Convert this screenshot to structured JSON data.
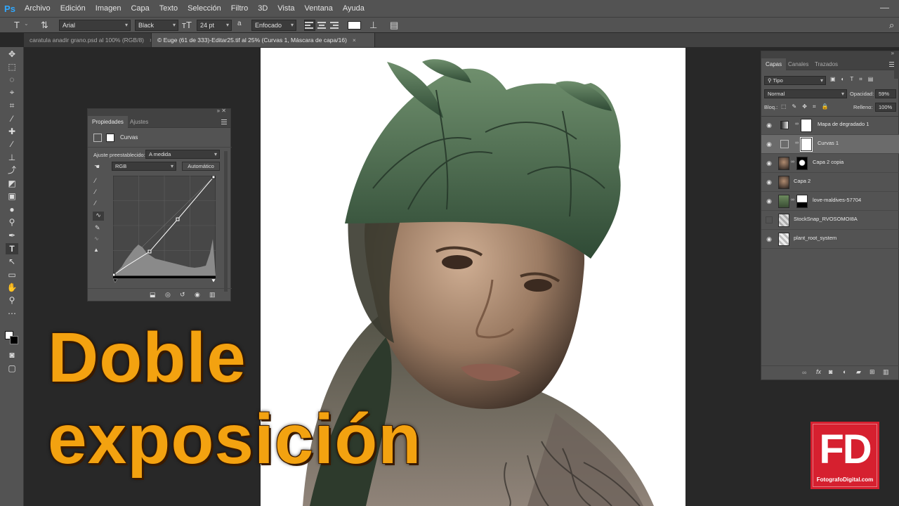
{
  "app": {
    "logo": "Ps",
    "menu": [
      "Archivo",
      "Edición",
      "Imagen",
      "Capa",
      "Texto",
      "Selección",
      "Filtro",
      "3D",
      "Vista",
      "Ventana",
      "Ayuda"
    ]
  },
  "options": {
    "font_family": "Arial",
    "font_style": "Black",
    "font_size": "24 pt",
    "aa_label": "a",
    "antialias": "Enfocado"
  },
  "tabs": [
    {
      "label": "caratula anadir grano.psd al 100% (RGB/8)",
      "close": "×"
    },
    {
      "label": "© Euge (61 de 333)-Editar25.tif al 25% (Curvas 1, Máscara de capa/16)",
      "close": "×"
    }
  ],
  "properties": {
    "tabs": [
      "Propiedades",
      "Ajustes"
    ],
    "title": "Curvas",
    "preset_label": "Ajuste preestablecido:",
    "preset_value": "A medida",
    "channel": "RGB",
    "auto_button": "Automático"
  },
  "layers_panel": {
    "tabs": [
      "Capas",
      "Canales",
      "Trazados"
    ],
    "filter": "Tipo",
    "blend_mode": "Normal",
    "opacity_label": "Opacidad:",
    "opacity_value": "59%",
    "lock_label": "Bloq.:",
    "fill_label": "Relleno:",
    "fill_value": "100%",
    "layers": [
      {
        "name": "Mapa de degradado 1",
        "visible": true,
        "selected": false
      },
      {
        "name": "Curvas 1",
        "visible": true,
        "selected": true
      },
      {
        "name": "Capa 2 copia",
        "visible": true,
        "selected": false
      },
      {
        "name": "Capa 2",
        "visible": true,
        "selected": false
      },
      {
        "name": "love-maldives-57704",
        "visible": true,
        "selected": false
      },
      {
        "name": "StockSnap_RVOSOMOI8A",
        "visible": false,
        "selected": false
      },
      {
        "name": "plant_root_system",
        "visible": true,
        "selected": false
      }
    ]
  },
  "overlay": {
    "line1": "Doble",
    "line2": "exposición",
    "color": "#f3a210"
  },
  "logo": {
    "letters": "FD",
    "site": "FotografoDigital.com",
    "color": "#d6202f"
  }
}
